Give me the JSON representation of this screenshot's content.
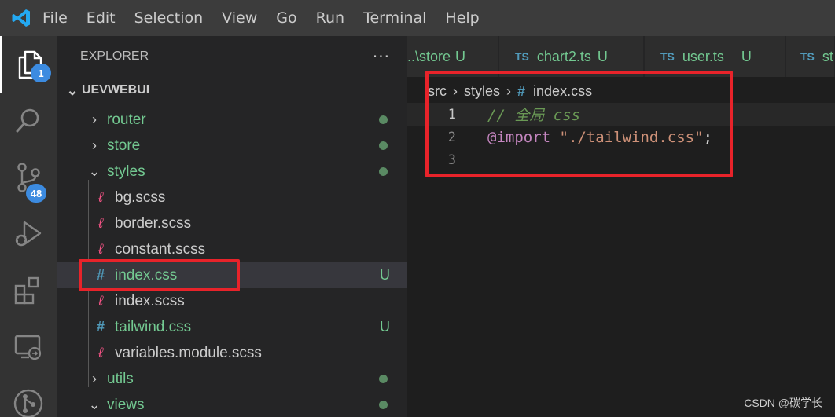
{
  "menubar": {
    "items": [
      {
        "mnemonic": "F",
        "rest": "ile"
      },
      {
        "mnemonic": "E",
        "rest": "dit"
      },
      {
        "mnemonic": "S",
        "rest": "election"
      },
      {
        "mnemonic": "V",
        "rest": "iew"
      },
      {
        "mnemonic": "G",
        "rest": "o"
      },
      {
        "mnemonic": "R",
        "rest": "un"
      },
      {
        "mnemonic": "T",
        "rest": "erminal"
      },
      {
        "mnemonic": "H",
        "rest": "elp"
      }
    ]
  },
  "activity": {
    "explorer_badge": "1",
    "scm_badge": "48"
  },
  "sidebar": {
    "title": "EXPLORER",
    "more": "···",
    "project": "UEVWEBUI",
    "rows": [
      {
        "label": "router"
      },
      {
        "label": "store"
      },
      {
        "label": "styles"
      },
      {
        "label": "bg.scss"
      },
      {
        "label": "border.scss"
      },
      {
        "label": "constant.scss"
      },
      {
        "label": "index.css",
        "status": "U"
      },
      {
        "label": "index.scss"
      },
      {
        "label": "tailwind.css",
        "status": "U"
      },
      {
        "label": "variables.module.scss"
      },
      {
        "label": "utils"
      },
      {
        "label": "views"
      }
    ]
  },
  "tabs": [
    {
      "name": "..\\store",
      "status": "U"
    },
    {
      "icon": "TS",
      "name": "chart2.ts",
      "status": "U"
    },
    {
      "icon": "TS",
      "name": "user.ts",
      "status": "U"
    },
    {
      "icon": "TS",
      "name": "st"
    }
  ],
  "editor": {
    "breadcrumb": [
      "src",
      "styles",
      "index.css"
    ],
    "lines": [
      {
        "number": "1",
        "comment": "// 全局 css"
      },
      {
        "number": "2",
        "at": "@import",
        "space": " ",
        "string": "\"./tailwind.css\"",
        "punct": ";"
      },
      {
        "number": "3"
      }
    ]
  },
  "watermark": "CSDN @碳学长",
  "colors": {
    "accent": "#3c8be0",
    "git_untracked": "#73c991",
    "annotation_red": "#e8232a"
  }
}
